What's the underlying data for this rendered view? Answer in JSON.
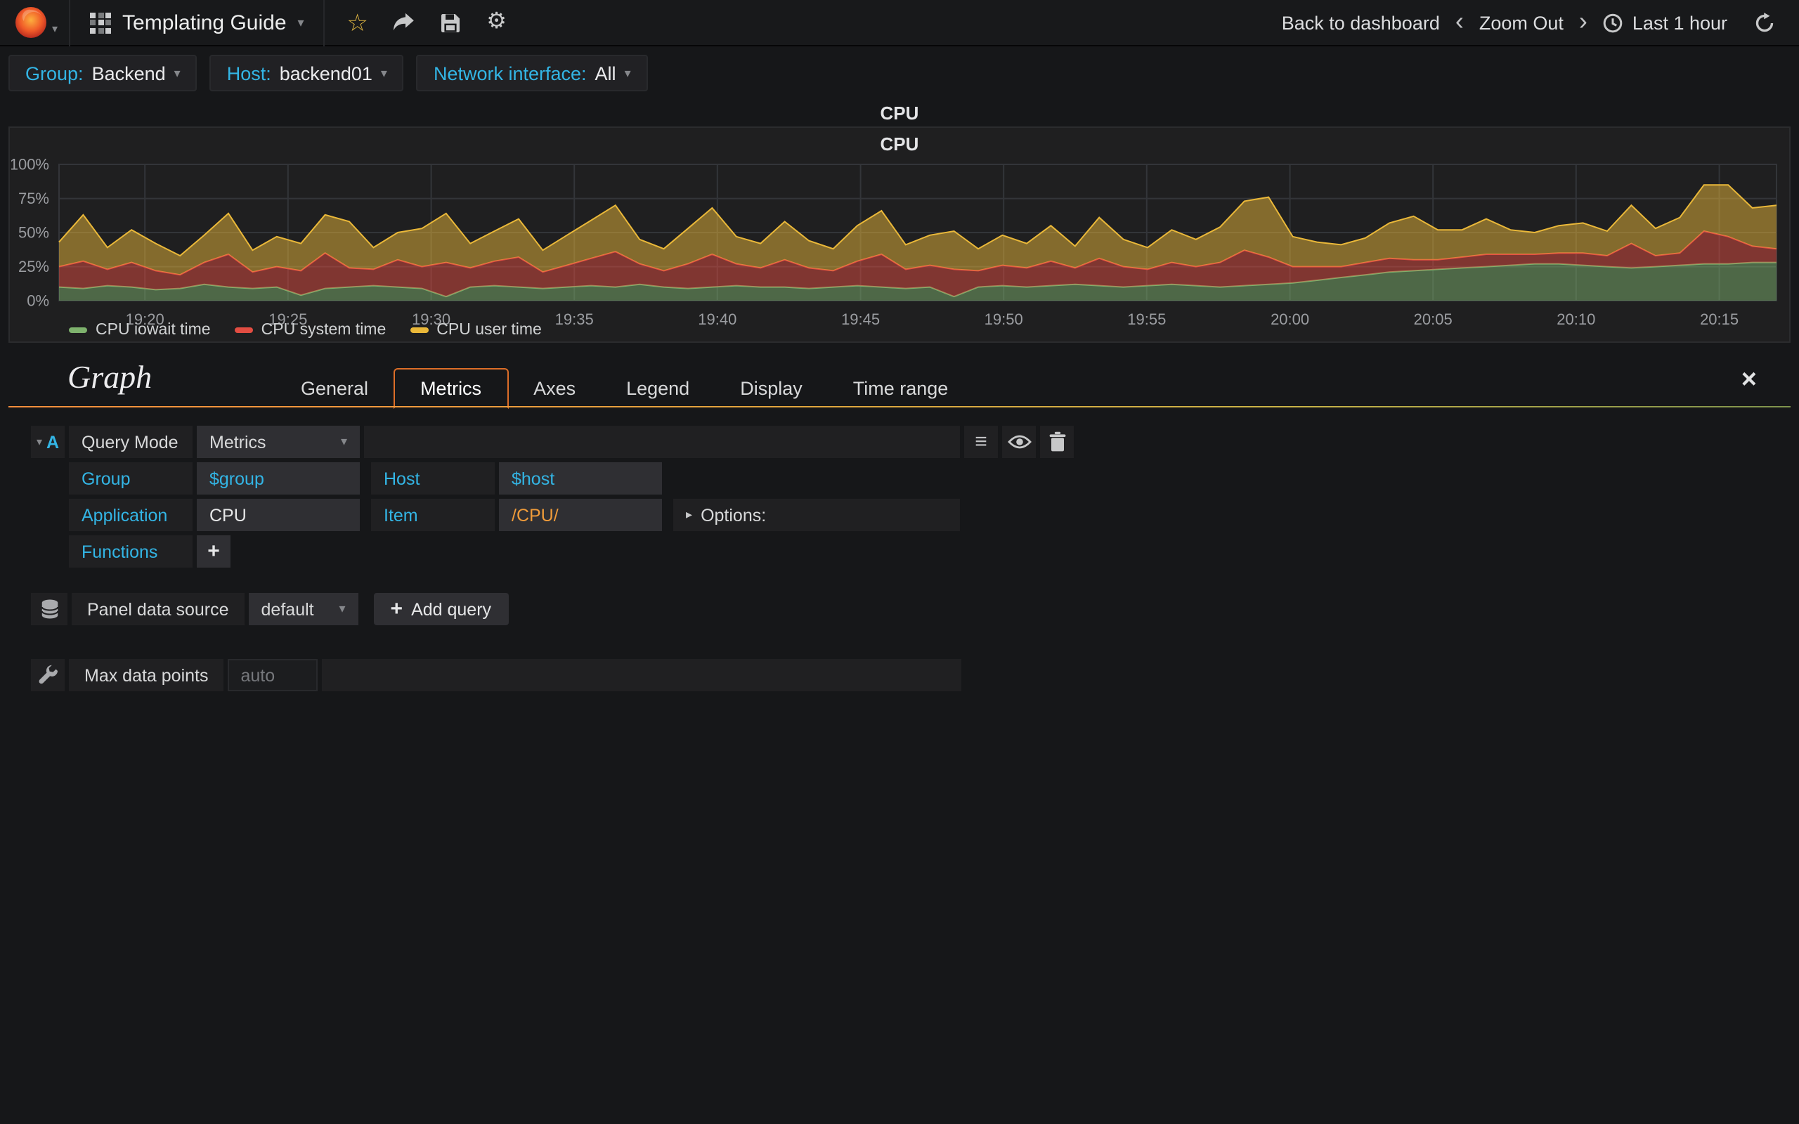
{
  "navbar": {
    "title": "Templating Guide",
    "back_to_dashboard_label": "Back to dashboard",
    "zoom_out_label": "Zoom Out",
    "time_range_label": "Last 1 hour"
  },
  "template_vars": [
    {
      "label": "Group:",
      "value": "Backend"
    },
    {
      "label": "Host:",
      "value": "backend01"
    },
    {
      "label": "Network interface:",
      "value": "All"
    }
  ],
  "panel": {
    "header_title": "CPU",
    "title": "CPU"
  },
  "chart_data": {
    "type": "area",
    "stacked": true,
    "title": "CPU",
    "ylim": [
      0,
      100
    ],
    "x_range_minutes": [
      0,
      60
    ],
    "grid": true,
    "legend_position": "bottom-left",
    "y_ticks": [
      {
        "v": 0,
        "label": "0%"
      },
      {
        "v": 25,
        "label": "25%"
      },
      {
        "v": 50,
        "label": "50%"
      },
      {
        "v": 75,
        "label": "75%"
      },
      {
        "v": 100,
        "label": "100%"
      }
    ],
    "x_ticks": [
      {
        "m": 3,
        "label": "19:20"
      },
      {
        "m": 8,
        "label": "19:25"
      },
      {
        "m": 13,
        "label": "19:30"
      },
      {
        "m": 18,
        "label": "19:35"
      },
      {
        "m": 23,
        "label": "19:40"
      },
      {
        "m": 28,
        "label": "19:45"
      },
      {
        "m": 33,
        "label": "19:50"
      },
      {
        "m": 38,
        "label": "19:55"
      },
      {
        "m": 43,
        "label": "20:00"
      },
      {
        "m": 48,
        "label": "20:05"
      },
      {
        "m": 53,
        "label": "20:10"
      },
      {
        "m": 58,
        "label": "20:15"
      }
    ],
    "series": [
      {
        "name": "CPU iowait time",
        "color": "#7EB26D",
        "values": [
          10,
          9,
          11,
          10,
          8,
          9,
          12,
          10,
          9,
          10,
          4,
          9,
          10,
          11,
          10,
          9,
          3,
          10,
          11,
          10,
          9,
          10,
          11,
          10,
          12,
          10,
          9,
          10,
          11,
          10,
          10,
          9,
          10,
          11,
          10,
          9,
          10,
          3,
          10,
          11,
          10,
          11,
          12,
          11,
          10,
          11,
          12,
          11,
          10,
          11,
          12,
          13,
          15,
          17,
          19,
          21,
          22,
          23,
          24,
          25,
          26,
          27,
          27,
          26,
          25,
          24,
          25,
          26,
          27,
          27,
          28,
          28
        ]
      },
      {
        "name": "CPU system time",
        "color": "#E24D42",
        "values": [
          15,
          20,
          12,
          18,
          14,
          10,
          16,
          24,
          12,
          15,
          18,
          26,
          14,
          12,
          20,
          16,
          25,
          14,
          18,
          22,
          12,
          16,
          20,
          26,
          15,
          12,
          18,
          24,
          16,
          14,
          20,
          15,
          12,
          18,
          24,
          14,
          16,
          20,
          12,
          15,
          14,
          18,
          12,
          20,
          15,
          12,
          16,
          14,
          18,
          26,
          20,
          12,
          10,
          8,
          9,
          10,
          8,
          7,
          8,
          9,
          8,
          7,
          8,
          9,
          8,
          18,
          8,
          9,
          24,
          20,
          12,
          10
        ]
      },
      {
        "name": "CPU user time",
        "color": "#EAB839",
        "values": [
          18,
          34,
          16,
          24,
          20,
          14,
          20,
          30,
          16,
          22,
          20,
          28,
          34,
          16,
          20,
          28,
          36,
          18,
          22,
          28,
          16,
          22,
          28,
          34,
          18,
          16,
          26,
          34,
          20,
          18,
          28,
          20,
          16,
          26,
          32,
          18,
          22,
          28,
          16,
          22,
          18,
          26,
          16,
          30,
          20,
          16,
          24,
          20,
          26,
          36,
          44,
          22,
          18,
          16,
          18,
          26,
          32,
          22,
          20,
          26,
          18,
          16,
          20,
          22,
          18,
          28,
          20,
          26,
          34,
          38,
          28,
          32
        ]
      }
    ]
  },
  "editor": {
    "panel_type_label": "Graph",
    "tabs": [
      "General",
      "Metrics",
      "Axes",
      "Legend",
      "Display",
      "Time range"
    ],
    "active_tab": "Metrics",
    "query": {
      "ref_id": "A",
      "query_mode_label": "Query Mode",
      "query_mode_value": "Metrics",
      "group_label": "Group",
      "group_value": "$group",
      "host_label": "Host",
      "host_value": "$host",
      "application_label": "Application",
      "application_value": "CPU",
      "item_label": "Item",
      "item_value": "/CPU/",
      "options_label": "Options:",
      "functions_label": "Functions",
      "add_function_label": "+"
    },
    "datasource_row": {
      "label": "Panel data source",
      "value": "default",
      "add_query_label": "Add query"
    },
    "max_data_points": {
      "label": "Max data points",
      "placeholder": "auto"
    }
  },
  "colors": {
    "accent_blue": "#33B5E5",
    "brand_orange": "#EB7B18",
    "item_regex_orange": "#EF9B3A",
    "panel_bg": "#1F1F20",
    "page_bg": "#161719"
  }
}
